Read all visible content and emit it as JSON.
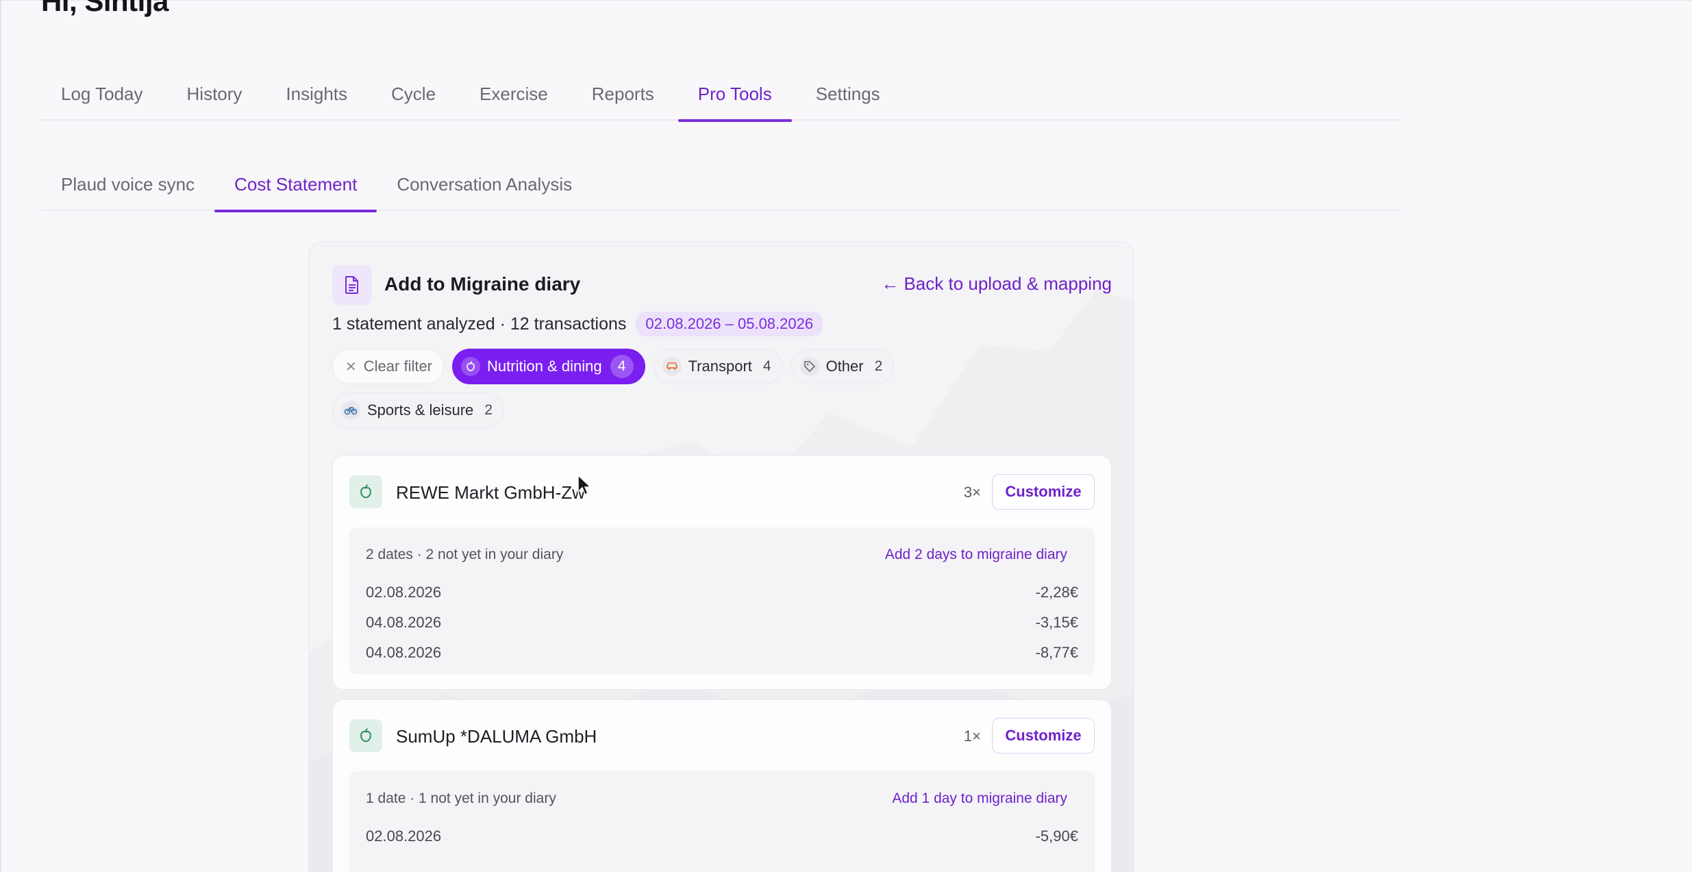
{
  "greeting": "Hi, Sintija",
  "main_tabs": [
    {
      "label": "Log Today",
      "active": false
    },
    {
      "label": "History",
      "active": false
    },
    {
      "label": "Insights",
      "active": false
    },
    {
      "label": "Cycle",
      "active": false
    },
    {
      "label": "Exercise",
      "active": false
    },
    {
      "label": "Reports",
      "active": false
    },
    {
      "label": "Pro Tools",
      "active": true
    },
    {
      "label": "Settings",
      "active": false
    }
  ],
  "sub_tabs": [
    {
      "label": "Plaud voice sync",
      "active": false
    },
    {
      "label": "Cost Statement",
      "active": true
    },
    {
      "label": "Conversation Analysis",
      "active": false
    }
  ],
  "panel": {
    "title": "Add to Migraine diary",
    "back_link": "← Back to upload & mapping",
    "summary": "1 statement analyzed · 12 transactions",
    "date_range": "02.08.2026 – 05.08.2026",
    "clear_filter": "Clear filter",
    "chips": [
      {
        "label": "Nutrition & dining",
        "count": "4",
        "icon": "apple-icon",
        "active": true
      },
      {
        "label": "Transport",
        "count": "4",
        "icon": "car-icon",
        "active": false
      },
      {
        "label": "Other",
        "count": "2",
        "icon": "tag-icon",
        "active": false
      },
      {
        "label": "Sports & leisure",
        "count": "2",
        "icon": "bicycle-icon",
        "active": false
      }
    ],
    "merchants": [
      {
        "name": "REWE Markt GmbH-Zw",
        "times": "3×",
        "customize": "Customize",
        "info": "2 dates · 2 not yet in your diary",
        "add_label": "Add 2 days to migraine diary",
        "rows": [
          {
            "date": "02.08.2026",
            "amount": "-2,28€"
          },
          {
            "date": "04.08.2026",
            "amount": "-3,15€"
          },
          {
            "date": "04.08.2026",
            "amount": "-8,77€"
          }
        ]
      },
      {
        "name": "SumUp *DALUMA GmbH",
        "times": "1×",
        "customize": "Customize",
        "info": "1 date · 1 not yet in your diary",
        "add_label": "Add 1 day to migraine diary",
        "rows": [
          {
            "date": "02.08.2026",
            "amount": "-5,90€"
          }
        ]
      }
    ]
  },
  "colors": {
    "accent": "#7a1ff0",
    "accent_text": "#6e22c9",
    "merchant_icon_bg": "#e2f0ea"
  }
}
